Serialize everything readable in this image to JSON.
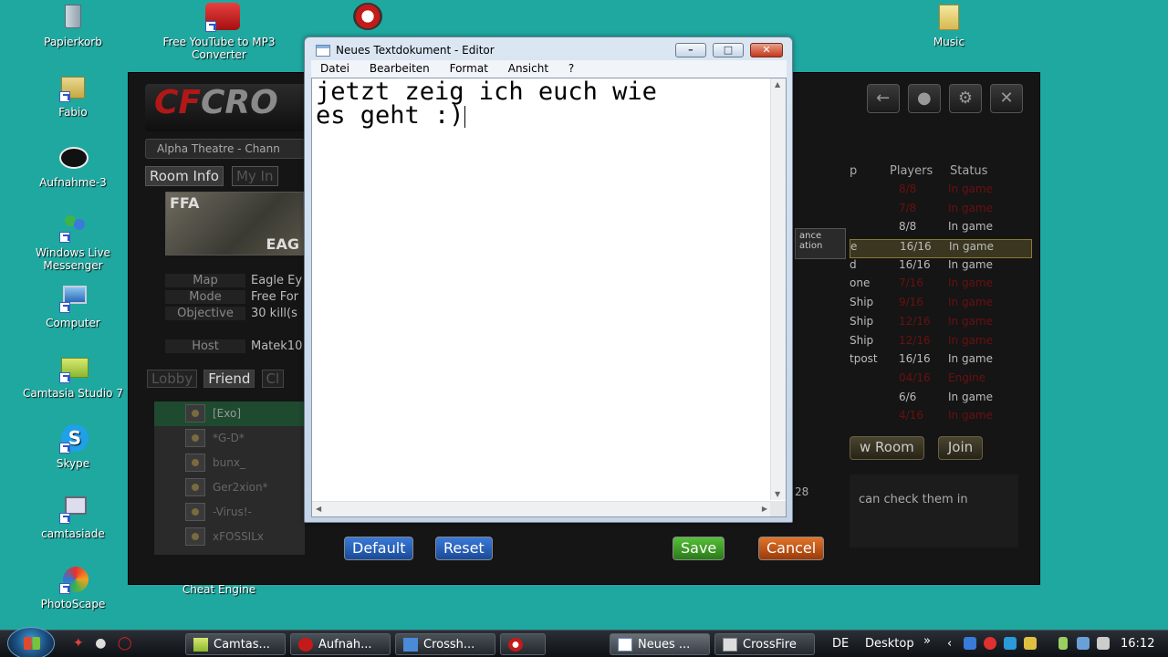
{
  "desktop": {
    "icons": [
      {
        "label": "Papierkorb",
        "icon": "recycle-bin-icon"
      },
      {
        "label": "Free YouTube to MP3 Converter",
        "icon": "youtube-mp3-icon"
      },
      {
        "label": "Fabio",
        "icon": "folder-shortcut-icon"
      },
      {
        "label": "Aufnahme-3",
        "icon": "recording-icon"
      },
      {
        "label": "Windows Live Messenger",
        "icon": "messenger-icon"
      },
      {
        "label": "Computer",
        "icon": "computer-icon"
      },
      {
        "label": "Camtasia Studio 7",
        "icon": "camtasia-icon"
      },
      {
        "label": "Skype",
        "icon": "skype-icon"
      },
      {
        "label": "camtasiade",
        "icon": "camtasiade-icon"
      },
      {
        "label": "PhotoScape",
        "icon": "photoscape-icon"
      },
      {
        "label": "Cheat Engine",
        "icon": "cheat-engine-icon"
      },
      {
        "label": "Music",
        "icon": "music-folder-icon"
      }
    ]
  },
  "game": {
    "logo_text": "CRO",
    "channel": "Alpha Theatre - Chann",
    "tabs": [
      "Room Info",
      "My In"
    ],
    "thumb_mode": "FFA",
    "thumb_map": "EAG",
    "info": [
      {
        "key": "Map",
        "value": "Eagle Ey"
      },
      {
        "key": "Mode",
        "value": "Free For"
      },
      {
        "key": "Objective",
        "value": "30 kill(s"
      },
      {
        "key": "Host",
        "value": "Matek10"
      }
    ],
    "subtabs": [
      "Lobby",
      "Friend",
      "Cl"
    ],
    "friends": [
      "[Exo]",
      "*G-D*",
      "bunx_",
      "Ger2xion*",
      "-Virus!-",
      "xFOSSILx"
    ],
    "list_headers": [
      "p",
      "Players",
      "Status"
    ],
    "list_rows": [
      {
        "name": "",
        "players": "8/8",
        "status": "In game",
        "red": true
      },
      {
        "name": "",
        "players": "7/8",
        "status": "In game",
        "red": true
      },
      {
        "name": "",
        "players": "8/8",
        "status": "In game",
        "red": false
      },
      {
        "name": "e",
        "players": "16/16",
        "status": "In game",
        "red": false,
        "selected": true
      },
      {
        "name": "d",
        "players": "16/16",
        "status": "In game",
        "red": false
      },
      {
        "name": "one",
        "players": "7/16",
        "status": "In game",
        "red": true
      },
      {
        "name": "Ship",
        "players": "9/16",
        "status": "In game",
        "red": true
      },
      {
        "name": "Ship",
        "players": "12/16",
        "status": "In game",
        "red": true
      },
      {
        "name": "Ship",
        "players": "12/16",
        "status": "In game",
        "red": true
      },
      {
        "name": "tpost",
        "players": "16/16",
        "status": "In game",
        "red": false
      },
      {
        "name": "",
        "players": "04/16",
        "status": "Engine",
        "red": true
      },
      {
        "name": "",
        "players": "6/6",
        "status": "In game",
        "red": false
      },
      {
        "name": "",
        "players": "4/16",
        "status": "In game",
        "red": true
      }
    ],
    "new_room": "w Room",
    "join": "Join",
    "chat_text": "can check them in",
    "mode_label_1": "ance",
    "mode_label_2": "ation",
    "count_fragment": "28",
    "buttons": {
      "default": "Default",
      "reset": "Reset",
      "save": "Save",
      "cancel": "Cancel"
    }
  },
  "notepad": {
    "title": "Neues Textdokument - Editor",
    "menu": [
      "Datei",
      "Bearbeiten",
      "Format",
      "Ansicht",
      "?"
    ],
    "content": "jetzt zeig ich euch wie\nes geht :)"
  },
  "taskbar": {
    "items": [
      {
        "label": "Camtas...",
        "icon": "camtasia-icon"
      },
      {
        "label": "Aufnah...",
        "icon": "recording-icon"
      },
      {
        "label": "Crossh...",
        "icon": "crosshair-icon"
      },
      {
        "label": "",
        "icon": "crossfire-icon"
      },
      {
        "label": "Neues ...",
        "icon": "notepad-icon",
        "active": true
      },
      {
        "label": "CrossFire",
        "icon": "crossfire-window-icon"
      }
    ],
    "language": "DE",
    "desktop_label": "Desktop",
    "time": "16:12"
  }
}
